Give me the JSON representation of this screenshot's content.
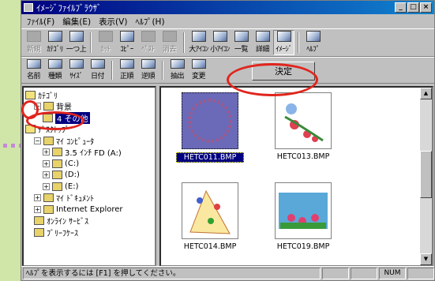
{
  "window": {
    "title": "ｲﾒｰｼﾞﾌｧｲﾙﾌﾞﾗｳｻﾞ"
  },
  "menu": [
    "ﾌｧｲﾙ(F)",
    "編集(E)",
    "表示(V)",
    "ﾍﾙﾌﾟ(H)"
  ],
  "toolbar1": [
    {
      "label": "新規",
      "disabled": true
    },
    {
      "label": "ｶﾃｺﾞﾘ",
      "disabled": false
    },
    {
      "label": "一つ上",
      "disabled": false
    },
    {
      "label": "ｶｯﾄ",
      "disabled": true
    },
    {
      "label": "ｺﾋﾟｰ",
      "disabled": false
    },
    {
      "label": "ﾍﾟｽﾄ",
      "disabled": true
    },
    {
      "label": "消去",
      "disabled": true
    },
    {
      "label": "大ｱｲｺﾝ",
      "disabled": false
    },
    {
      "label": "小ｱｲｺﾝ",
      "disabled": false
    },
    {
      "label": "一覧",
      "disabled": false
    },
    {
      "label": "詳細",
      "disabled": false
    },
    {
      "label": "ｲﾒｰｼﾞ",
      "disabled": false,
      "pressed": true
    },
    {
      "label": "ﾍﾙﾌﾟ",
      "disabled": false
    }
  ],
  "toolbar2": [
    {
      "label": "名前"
    },
    {
      "label": "種類"
    },
    {
      "label": "ｻｲｽﾞ"
    },
    {
      "label": "日付"
    },
    {
      "label": "正順"
    },
    {
      "label": "逆順"
    },
    {
      "label": "抽出"
    },
    {
      "label": "変更"
    }
  ],
  "decide_button": "決定",
  "tree": [
    {
      "label": "ｶﾃｺﾞﾘ",
      "expander": "",
      "indent": 0
    },
    {
      "label": "背景",
      "expander": "−",
      "indent": 1
    },
    {
      "label": "4 その他",
      "expander": "",
      "indent": 2,
      "selected": true
    },
    {
      "label": "ﾃﾞｽｸﾄｯﾌﾟ",
      "expander": "",
      "indent": 0
    },
    {
      "label": "ﾏｲ ｺﾝﾋﾟｭｰﾀ",
      "expander": "−",
      "indent": 1
    },
    {
      "label": "3.5 ｲﾝﾁ FD (A:)",
      "expander": "+",
      "indent": 2
    },
    {
      "label": "(C:)",
      "expander": "+",
      "indent": 2
    },
    {
      "label": "(D:)",
      "expander": "+",
      "indent": 2
    },
    {
      "label": "(E:)",
      "expander": "+",
      "indent": 2
    },
    {
      "label": "ﾏｲ ﾄﾞｷｭﾒﾝﾄ",
      "expander": "+",
      "indent": 1
    },
    {
      "label": "Internet Explorer",
      "expander": "+",
      "indent": 1
    },
    {
      "label": "ｵﾝﾗｲﾝ ｻｰﾋﾞｽ",
      "expander": "",
      "indent": 1
    },
    {
      "label": "ﾌﾞﾘｰﾌｹｰｽ",
      "expander": "",
      "indent": 1
    }
  ],
  "images": [
    {
      "name": "HETC011.BMP",
      "selected": true
    },
    {
      "name": "HETC013.BMP",
      "selected": false
    },
    {
      "name": "HETC014.BMP",
      "selected": false
    },
    {
      "name": "HETC019.BMP",
      "selected": false
    }
  ],
  "status": {
    "text": "ﾍﾙﾌﾟを表示するには [F1] を押してください。",
    "num": "NUM"
  },
  "colors": {
    "highlight_ring": "#e0251d",
    "selection": "#000080"
  }
}
